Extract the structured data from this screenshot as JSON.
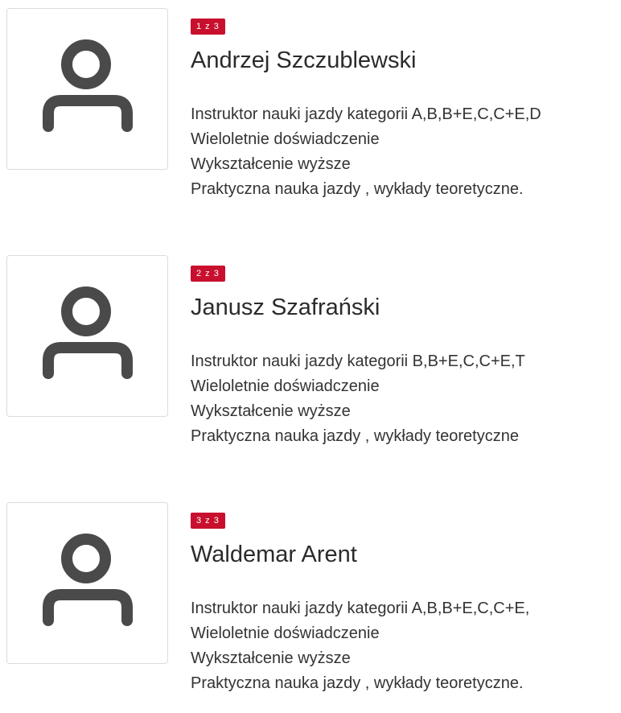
{
  "instructors": [
    {
      "counter": "1 z 3",
      "name": "Andrzej Szczublewski",
      "lines": [
        "Instruktor nauki jazdy kategorii A,B,B+E,C,C+E,D",
        "Wieloletnie doświadczenie",
        "Wykształcenie wyższe",
        "Praktyczna nauka jazdy , wykłady teoretyczne."
      ]
    },
    {
      "counter": "2 z 3",
      "name": "Janusz Szafrański",
      "lines": [
        "Instruktor nauki jazdy kategorii B,B+E,C,C+E,T",
        "Wieloletnie doświadczenie",
        "Wykształcenie wyższe",
        "Praktyczna nauka jazdy , wykłady teoretyczne"
      ]
    },
    {
      "counter": "3 z 3",
      "name": "Waldemar Arent",
      "lines": [
        "Instruktor nauki jazdy kategorii A,B,B+E,C,C+E,",
        "Wieloletnie doświadczenie",
        "Wykształcenie wyższe",
        "Praktyczna nauka jazdy , wykłady teoretyczne."
      ]
    }
  ],
  "icons": {
    "avatar": "user-placeholder-icon"
  },
  "colors": {
    "badge": "#c8102e",
    "icon": "#4a4a4a",
    "border": "#dcdcdc"
  }
}
